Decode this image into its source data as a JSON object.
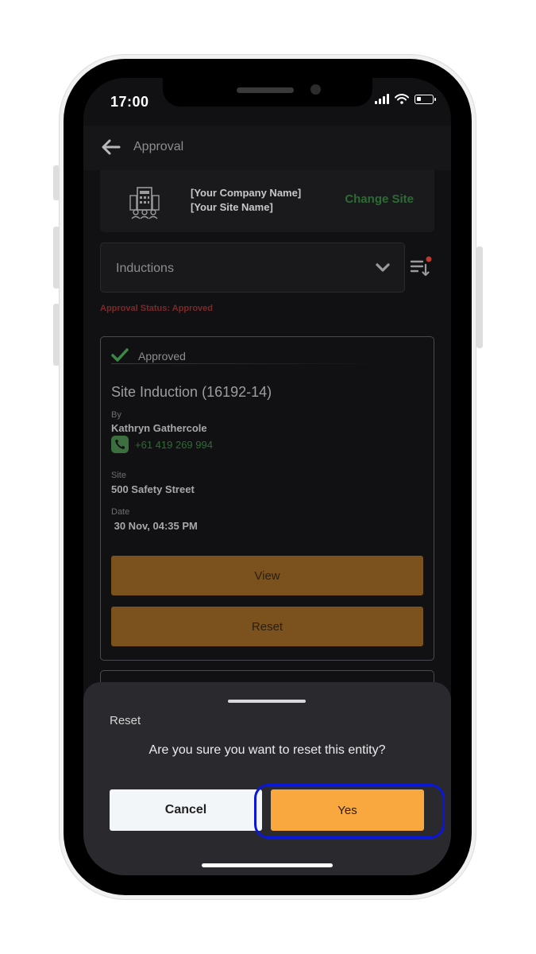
{
  "status_bar": {
    "time": "17:00"
  },
  "header": {
    "title": "Approval",
    "back_icon": "arrow-left-icon"
  },
  "site": {
    "company_name": "[Your Company Name]",
    "site_name": "[Your Site Name]",
    "change_site_label": "Change Site",
    "icon": "building-icon"
  },
  "filter": {
    "selected": "Inductions",
    "approval_status": "Approval Status: Approved"
  },
  "card": {
    "status": "Approved",
    "title": "Site Induction (16192-14)",
    "by_label": "By",
    "by_value": "Kathryn Gathercole",
    "phone": "+61 419 269 994",
    "site_label": "Site",
    "site_value": "500 Safety Street",
    "date_label": "Date",
    "date_value": " 30 Nov, 04:35 PM",
    "view_label": "View",
    "reset_label": "Reset"
  },
  "sheet": {
    "title": "Reset",
    "message": "Are you sure you want to reset this entity?",
    "cancel_label": "Cancel",
    "yes_label": "Yes"
  },
  "colors": {
    "accent": "#f8a83f",
    "muted_accent": "#7b521e",
    "success": "#2d6b35",
    "alert": "#7a2a2a",
    "highlight": "#0a16d8"
  }
}
